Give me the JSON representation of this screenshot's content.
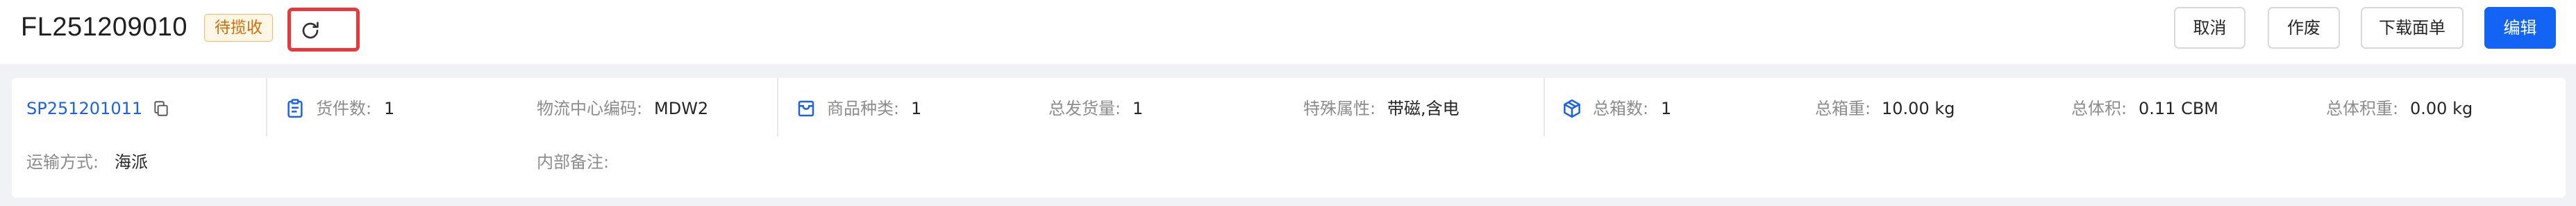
{
  "header": {
    "order_no": "FL251209010",
    "status": "待揽收",
    "buttons": {
      "cancel": "取消",
      "void": "作废",
      "download": "下载面单",
      "edit": "编辑"
    }
  },
  "info": {
    "tracking_no": "SP251201011",
    "pieces": {
      "label": "货件数:",
      "value": "1"
    },
    "center_code": {
      "label": "物流中心编码:",
      "value": "MDW2"
    },
    "sku_types": {
      "label": "商品种类:",
      "value": "1"
    },
    "total_qty": {
      "label": "总发货量:",
      "value": "1"
    },
    "special_attr": {
      "label": "特殊属性:",
      "value": "带磁,含电"
    },
    "boxes": {
      "label": "总箱数:",
      "value": "1"
    },
    "box_weight": {
      "label": "总箱重:",
      "value": "10.00 kg"
    },
    "volume": {
      "label": "总体积:",
      "value": "0.11 CBM"
    },
    "vol_weight": {
      "label": "总体积重:",
      "value": "0.00 kg"
    },
    "transport": {
      "label": "运输方式:",
      "value": "海派"
    },
    "remark": {
      "label": "内部备注:",
      "value": ""
    }
  },
  "colors": {
    "accent": "#1364f5",
    "link": "#1a63e8",
    "status_text": "#d46b08",
    "status_bg": "#fff7e6",
    "highlight_box": "#e8383d"
  },
  "icons": {
    "refresh": "refresh-icon",
    "copy": "copy-icon",
    "clipboard": "clipboard-icon",
    "inbox": "inbox-icon",
    "box": "box-icon"
  }
}
